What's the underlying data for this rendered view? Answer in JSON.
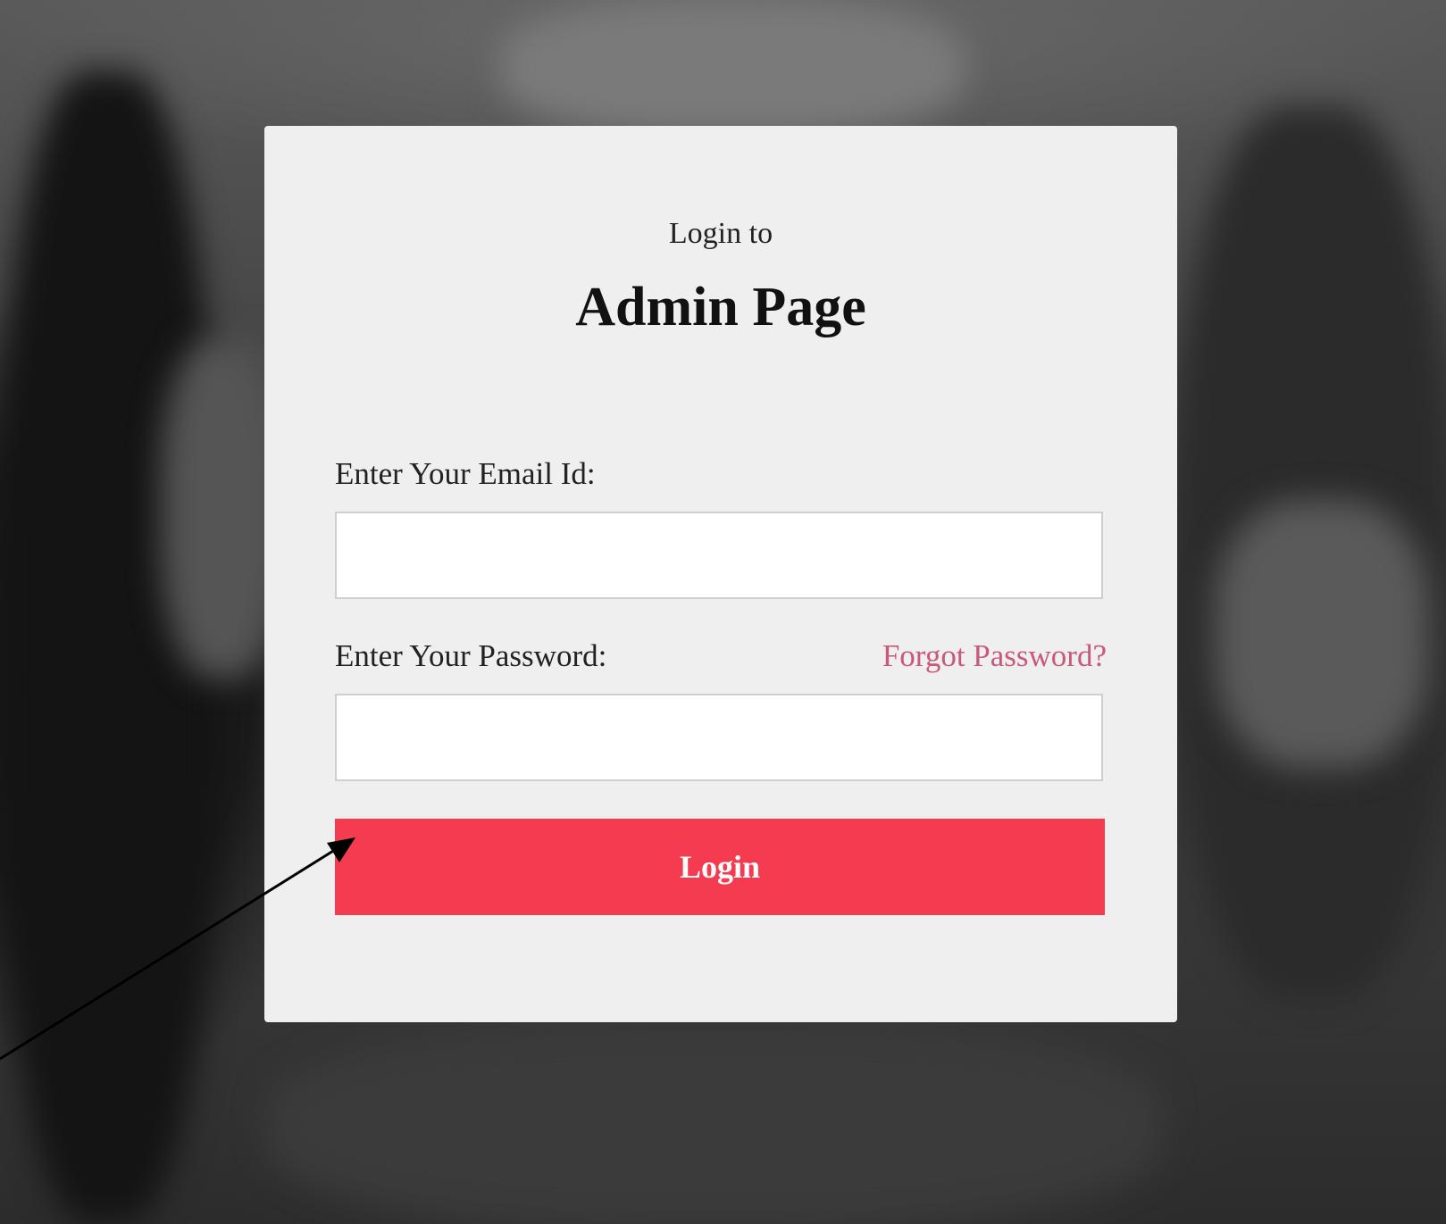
{
  "login": {
    "subtitle": "Login to",
    "title": "Admin Page",
    "email_label": "Enter Your Email Id:",
    "email_value": "",
    "password_label": "Enter Your Password:",
    "password_value": "",
    "forgot_link": "Forgot Password?",
    "submit_label": "Login"
  },
  "colors": {
    "card_bg": "#efefef",
    "button_bg": "#f43b4f",
    "link_color": "#c8597a"
  },
  "icons": {
    "annotation": "arrow-icon"
  }
}
